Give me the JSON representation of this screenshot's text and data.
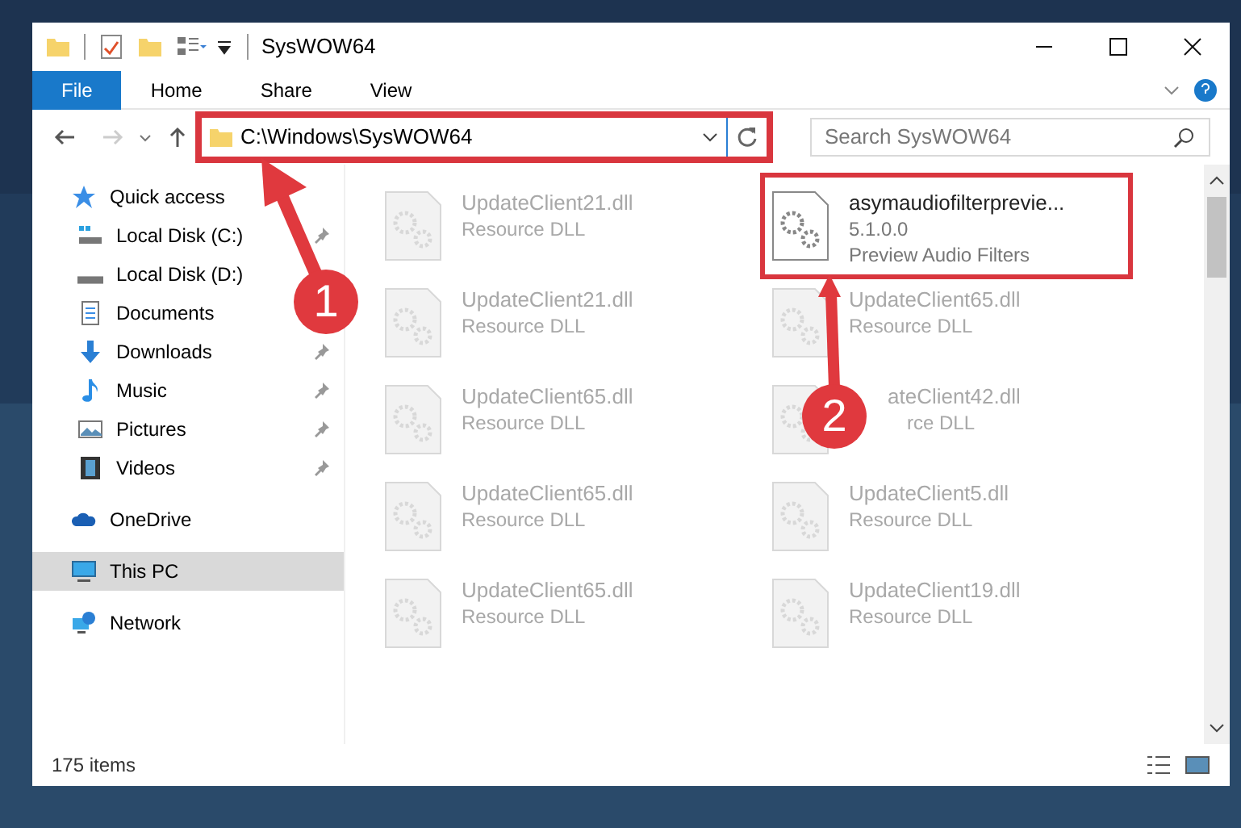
{
  "window": {
    "title": "SysWOW64"
  },
  "ribbon_tabs": [
    {
      "label": "File",
      "selected": true
    },
    {
      "label": "Home",
      "selected": false
    },
    {
      "label": "Share",
      "selected": false
    },
    {
      "label": "View",
      "selected": false
    }
  ],
  "address": {
    "value": "C:\\Windows\\SysWOW64",
    "highlighted": true
  },
  "search": {
    "placeholder": "Search SysWOW64"
  },
  "sidebar": {
    "items": [
      {
        "label": "Quick access",
        "kind": "star",
        "selected": false,
        "children": [
          {
            "label": "Local Disk (C:)",
            "kind": "drive-c",
            "pinned": true
          },
          {
            "label": "Local Disk (D:)",
            "kind": "drive"
          },
          {
            "label": "Documents",
            "kind": "document"
          },
          {
            "label": "Downloads",
            "kind": "download",
            "pinned": true
          },
          {
            "label": "Music",
            "kind": "music",
            "pinned": true
          },
          {
            "label": "Pictures",
            "kind": "pictures",
            "pinned": true
          },
          {
            "label": "Videos",
            "kind": "videos",
            "pinned": true
          }
        ]
      },
      {
        "label": "OneDrive",
        "kind": "cloud",
        "selected": false
      },
      {
        "label": "This PC",
        "kind": "pc",
        "selected": true
      },
      {
        "label": "Network",
        "kind": "network",
        "selected": false
      }
    ]
  },
  "files": [
    {
      "name": "UpdateClient21.dll",
      "type": "Resource DLL",
      "faded": true,
      "highlighted": false
    },
    {
      "name": "asymaudiofilterprevie...",
      "version": "5.1.0.0",
      "type": "Preview Audio Filters",
      "faded": false,
      "highlighted": true
    },
    {
      "name": "UpdateClient21.dll",
      "type": "Resource DLL",
      "faded": true,
      "highlighted": false
    },
    {
      "name": "UpdateClient65.dll",
      "type": "Resource DLL",
      "faded": true,
      "highlighted": false
    },
    {
      "name": "UpdateClient65.dll",
      "type": "Resource DLL",
      "faded": true,
      "highlighted": false
    },
    {
      "name": "ateClient42.dll",
      "type": "rce DLL",
      "faded": true,
      "highlighted": false,
      "covered": true
    },
    {
      "name": "UpdateClient65.dll",
      "type": "Resource DLL",
      "faded": true,
      "highlighted": false
    },
    {
      "name": "UpdateClient5.dll",
      "type": "Resource DLL",
      "faded": true,
      "highlighted": false
    },
    {
      "name": "UpdateClient65.dll",
      "type": "Resource DLL",
      "faded": true,
      "highlighted": false
    },
    {
      "name": "UpdateClient19.dll",
      "type": "Resource DLL",
      "faded": true,
      "highlighted": false
    }
  ],
  "status_bar": {
    "count": "175 items"
  },
  "annotations": [
    {
      "number": "1"
    },
    {
      "number": "2"
    }
  ]
}
